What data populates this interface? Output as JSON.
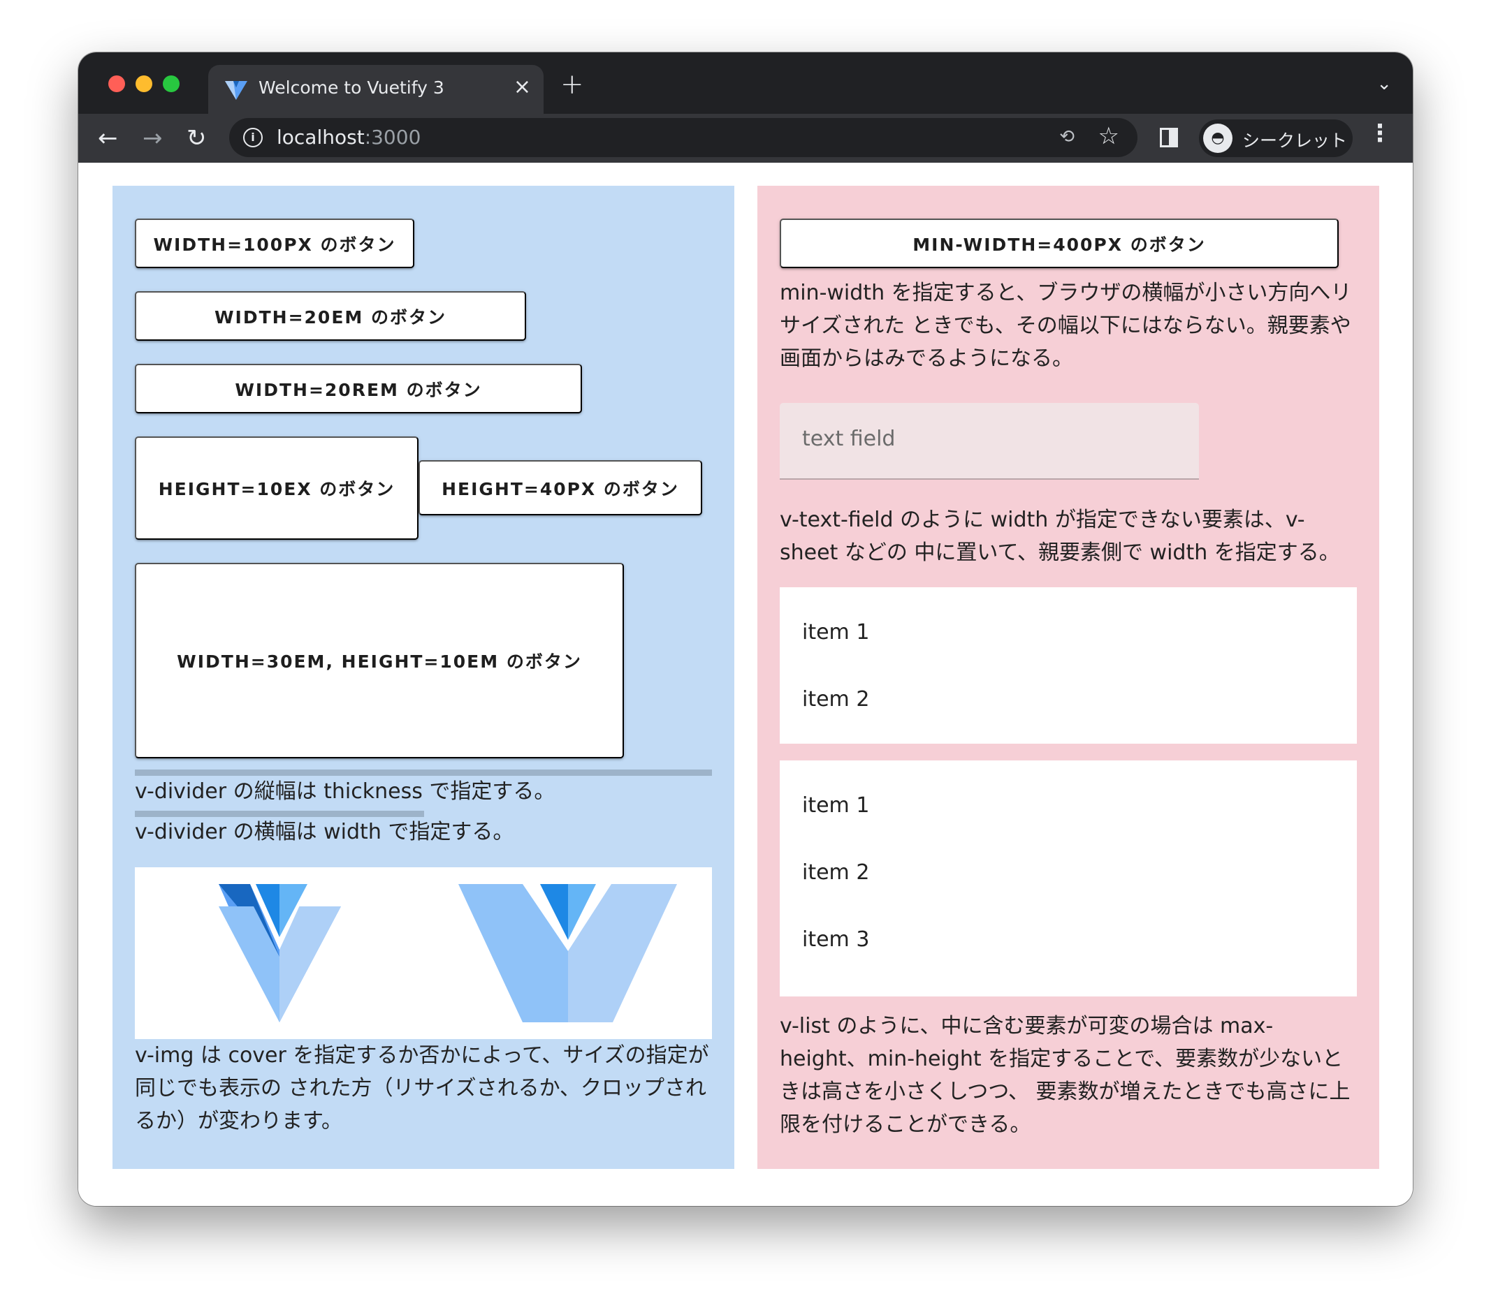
{
  "browser": {
    "tab_title": "Welcome to Vuetify 3",
    "tab_close": "×",
    "new_tab": "+",
    "url_host": "localhost",
    "url_port": ":3000",
    "incognito_label": "シークレット",
    "icons": [
      "back-arrow-icon",
      "forward-arrow-icon",
      "reload-icon",
      "info-icon",
      "translate-icon",
      "star-icon",
      "side-panel-icon",
      "incognito-icon",
      "kebab-menu-icon",
      "chevron-down-icon",
      "vuetify-logo-icon"
    ]
  },
  "left": {
    "buttons": {
      "w100px": "WIDTH=100PX のボタン",
      "w20em": "WIDTH=20EM のボタン",
      "w20rem": "WIDTH=20REM のボタン",
      "h10ex": "HEIGHT=10EX のボタン",
      "h40px": "HEIGHT=40PX のボタン",
      "w30em_h10em": "WIDTH=30EM, HEIGHT=10EM のボタン"
    },
    "divider_note_1": "v-divider の縦幅は thickness で指定する。",
    "divider_note_2": "v-divider の横幅は width で指定する。",
    "img_note": "v-img は cover を指定するか否かによって、サイズの指定が同じでも表示の された方（リサイズされるか、クロップされるか）が変わります。"
  },
  "right": {
    "min_width_button": "MIN-WIDTH=400PX のボタン",
    "min_width_note": "min-width を指定すると、ブラウザの横幅が小さい方向へリサイズされた ときでも、その幅以下にはならない。親要素や画面からはみでるようになる。",
    "text_field_label": "text field",
    "text_field_note": "v-text-field のように width が指定できない要素は、v-sheet などの 中に置いて、親要素側で width を指定する。",
    "list_a": [
      "item 1",
      "item 2"
    ],
    "list_b": [
      "item 1",
      "item 2",
      "item 3"
    ],
    "list_note": "v-list のように、中に含む要素が可変の場合は max-height、min-height を指定することで、要素数が少ないときは高さを小さくしつつ、 要素数が増えたときでも高さに上限を付けることができる。"
  },
  "colors": {
    "left_panel": "#c2dbf5",
    "right_panel": "#f6cfd6",
    "vuetify_blue_dark": "#1867c0",
    "vuetify_blue_mid": "#5a9ff5",
    "vuetify_blue_light": "#aed0f7"
  }
}
